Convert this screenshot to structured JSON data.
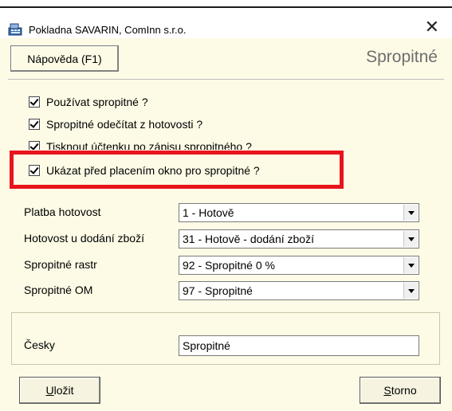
{
  "window": {
    "title": "Pokladna SAVARIN, ComInn s.r.o.",
    "close_glyph": "✕",
    "app_icon": "cash-register-icon"
  },
  "toolbar": {
    "help_label": "Nápověda (F1)",
    "section_title": "Spropitné"
  },
  "checkboxes": [
    {
      "label": "Používat spropitné ?",
      "checked": true
    },
    {
      "label": "Spropitné odečítat z hotovosti ?",
      "checked": true
    },
    {
      "label": "Tisknout účtenku po zápisu spropitného ?",
      "checked": true
    },
    {
      "label": "Ukázat před placením okno pro spropitné ?",
      "checked": true
    }
  ],
  "fields": [
    {
      "label": "Platba hotovost",
      "value": "1 - Hotově"
    },
    {
      "label": "Hotovost u dodání zboží",
      "value": "31 - Hotově - dodání zboží"
    },
    {
      "label": "Spropitné rastr",
      "value": "92 - Spropitné 0 %"
    },
    {
      "label": "Spropitné OM",
      "value": "97 - Spropitné"
    }
  ],
  "language": {
    "label": "Česky",
    "value": "Spropitné"
  },
  "buttons": {
    "save_label_first": "U",
    "save_label_rest": "ložit",
    "cancel_label_first": "S",
    "cancel_label_rest": "torno"
  },
  "colors": {
    "client_bg": "#fdfbe6",
    "highlight": "#e8141d",
    "section_title": "#6e6e6e"
  }
}
